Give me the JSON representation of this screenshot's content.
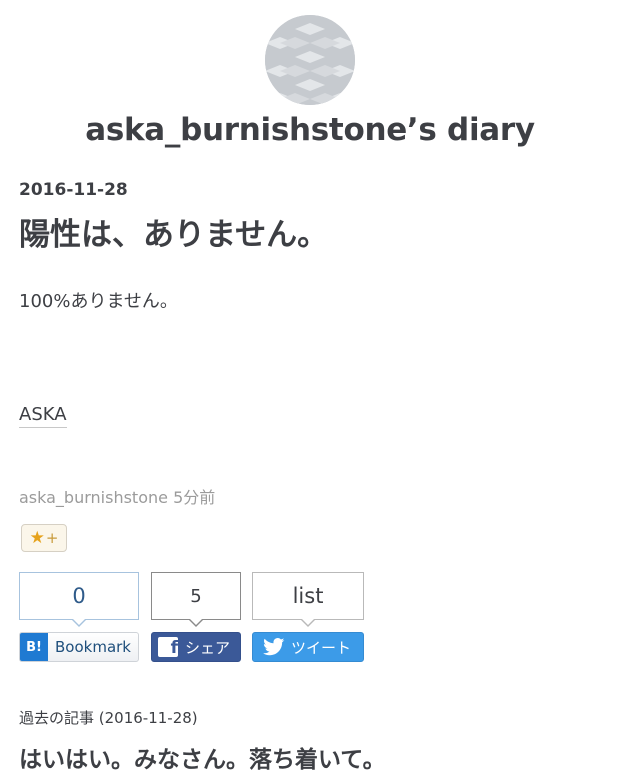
{
  "header": {
    "blog_title": "aska_burnishstone’s diary"
  },
  "entry": {
    "date": "2016-11-28",
    "title": "陽性は、ありません。",
    "body": "100%ありません。",
    "category": "ASKA",
    "author": "aska_burnishstone",
    "time_ago": "5分前"
  },
  "star_button": {
    "icon": "star-icon",
    "plus": "+"
  },
  "share": {
    "bookmark_count": "0",
    "facebook_count": "5",
    "twitter_count": "list",
    "bookmark_logo": "B!",
    "bookmark_label": "Bookmark",
    "facebook_label": "シェア",
    "twitter_label": "ツイート"
  },
  "previous": {
    "meta": "過去の記事 (2016-11-28)",
    "title": "はいはい。みなさん。落ち着いて。"
  },
  "colors": {
    "text": "#3d3f44",
    "muted": "#9b9b9b",
    "hatena_blue": "#1f7ad2",
    "facebook_blue": "#3b5998",
    "twitter_blue": "#3c9be8",
    "star": "#e6a21b"
  }
}
